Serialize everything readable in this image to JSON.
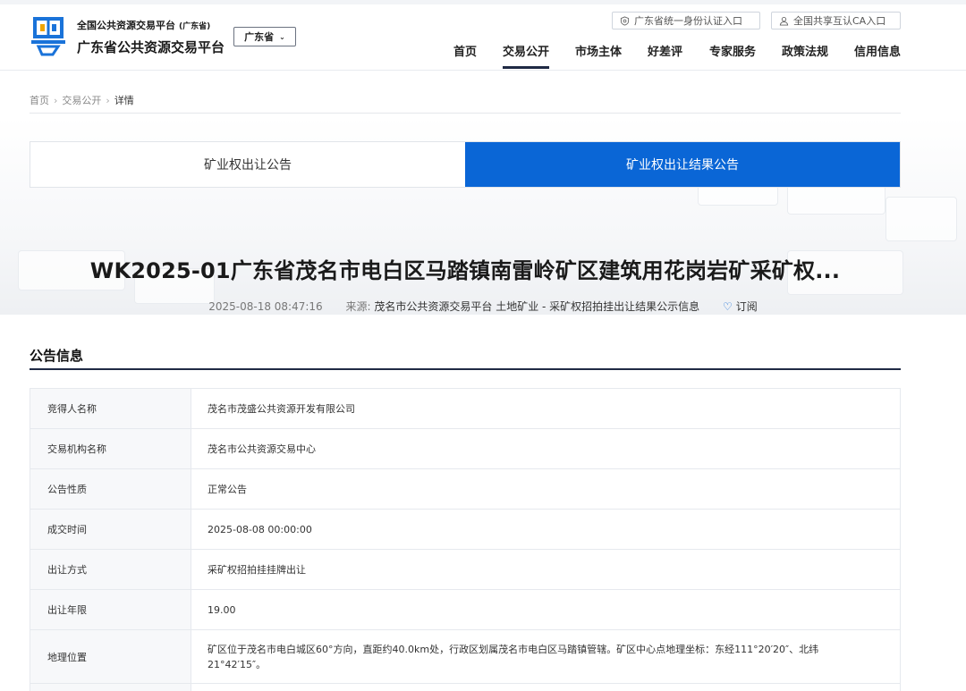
{
  "header": {
    "brand_small": "全国公共资源交易平台",
    "brand_small_province": "(广东省)",
    "brand_big": "广东省公共资源交易平台",
    "region_select": "广东省",
    "auth_links": [
      {
        "label": "广东省统一身份认证入口",
        "icon": "shield-icon"
      },
      {
        "label": "全国共享互认CA入口",
        "icon": "user-icon"
      }
    ],
    "nav": [
      {
        "label": "首页"
      },
      {
        "label": "交易公开",
        "active": true
      },
      {
        "label": "市场主体"
      },
      {
        "label": "好差评"
      },
      {
        "label": "专家服务"
      },
      {
        "label": "政策法规"
      },
      {
        "label": "信用信息"
      }
    ],
    "accent_color": "#0a66d6"
  },
  "breadcrumb": [
    "首页",
    "交易公开",
    "详情"
  ],
  "tabs": [
    {
      "label": "矿业权出让公告",
      "active": false
    },
    {
      "label": "矿业权出让结果公告",
      "active": true
    }
  ],
  "document": {
    "title": "WK2025-01广东省茂名市电白区马踏镇南雷岭矿区建筑用花岗岩矿采矿权...",
    "datetime": "2025-08-18 08:47:16",
    "source_label": "来源:",
    "source_value": "茂名市公共资源交易平台 土地矿业 - 采矿权招拍挂出让结果公示信息",
    "subscribe_label": "订阅"
  },
  "section": {
    "title": "公告信息"
  },
  "info_rows": [
    {
      "key": "竞得人名称",
      "value": "茂名市茂盛公共资源开发有限公司"
    },
    {
      "key": "交易机构名称",
      "value": "茂名市公共资源交易中心"
    },
    {
      "key": "公告性质",
      "value": "正常公告"
    },
    {
      "key": "成交时间",
      "value": "2025-08-08 00:00:00"
    },
    {
      "key": "出让方式",
      "value": "采矿权招拍挂挂牌出让"
    },
    {
      "key": "出让年限",
      "value": "19.00"
    },
    {
      "key": "地理位置",
      "value": "矿区位于茂名市电白城区60°方向，直距约40.0km处，行政区划属茂名市电白区马踏镇管辖。矿区中心点地理坐标：东经111°20′20″、北纬21°42′15″。"
    }
  ]
}
